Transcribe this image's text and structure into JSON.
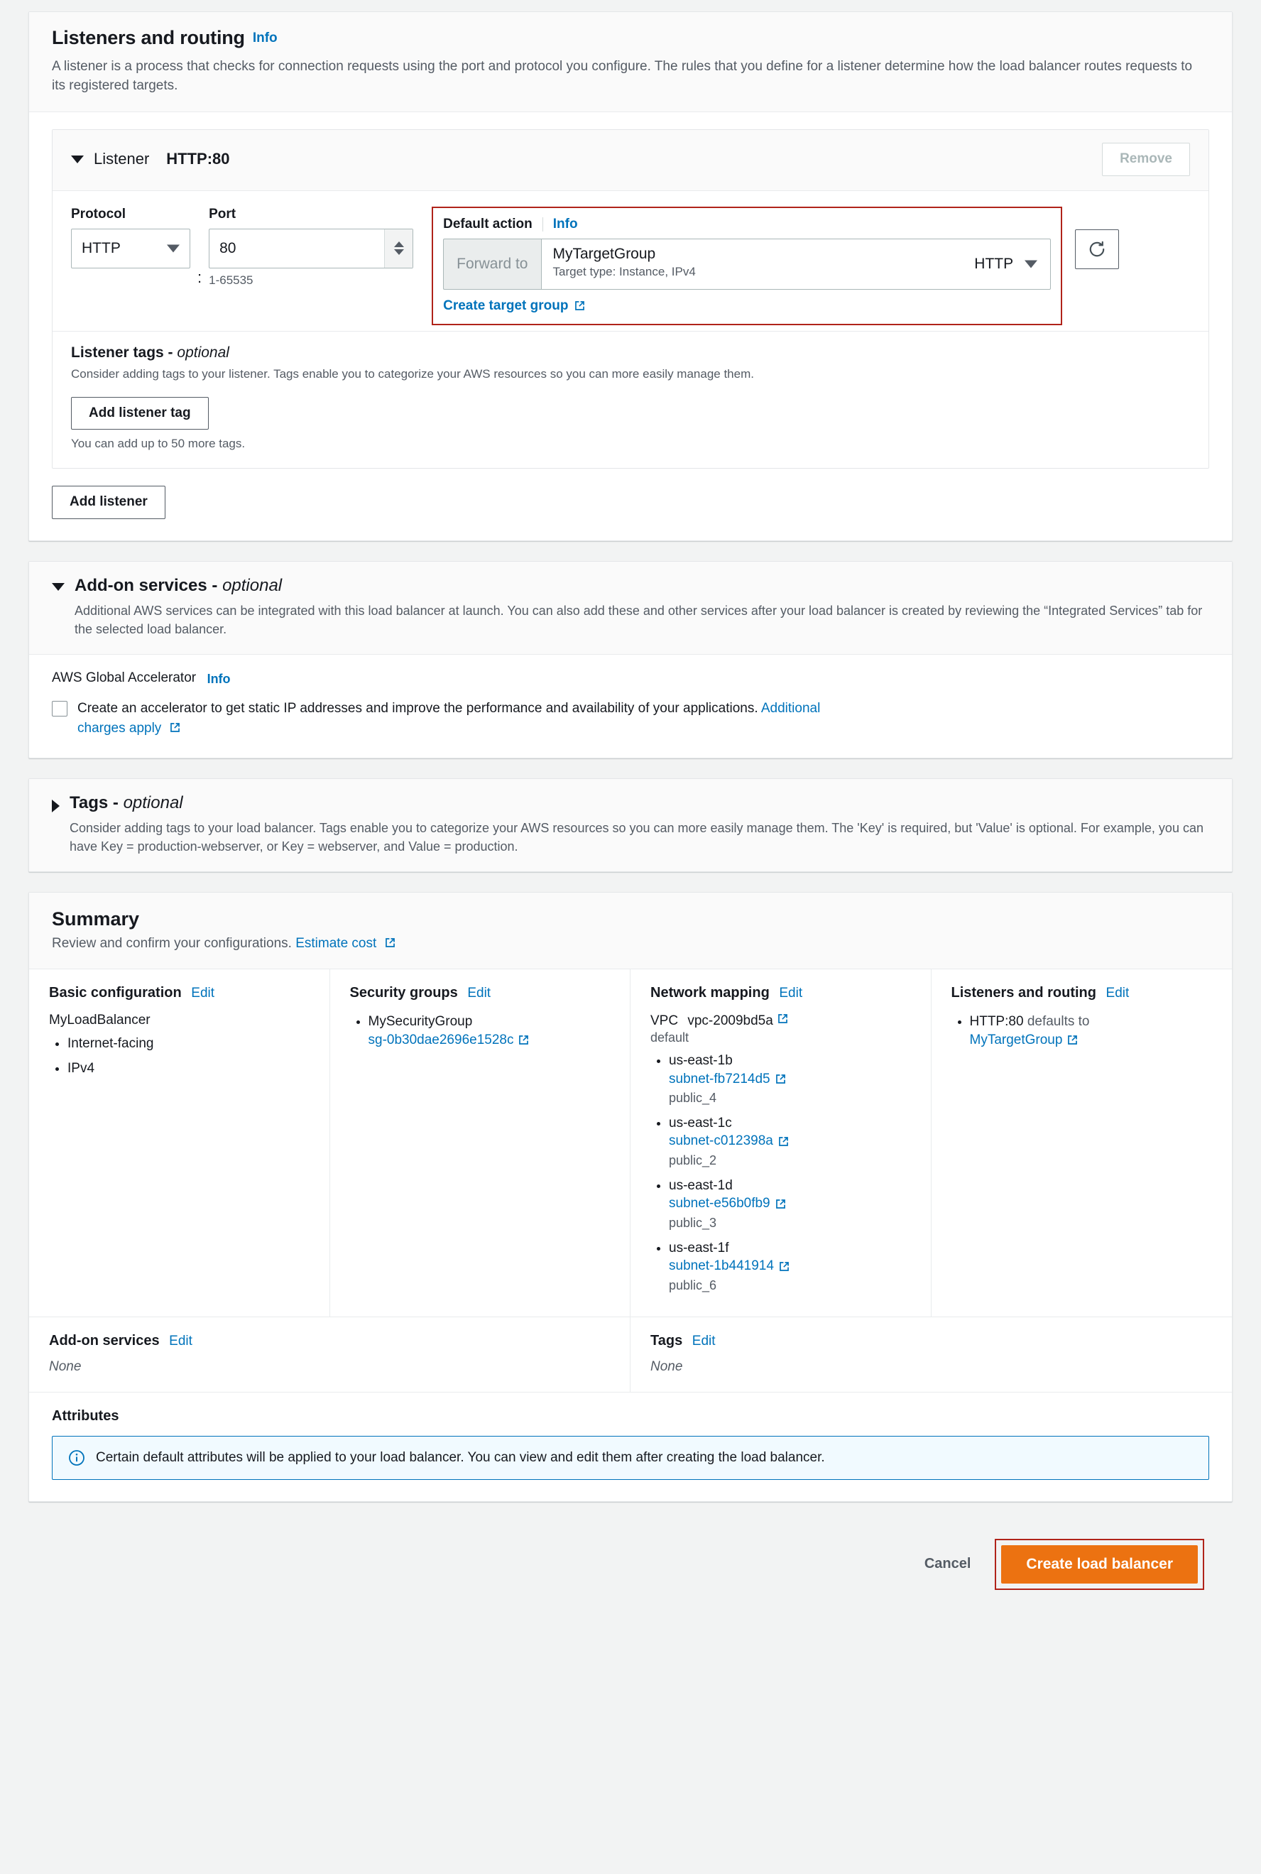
{
  "listeners_section": {
    "title": "Listeners and routing",
    "info_label": "Info",
    "description": "A listener is a process that checks for connection requests using the port and protocol you configure. The rules that you define for a listener determine how the load balancer routes requests to its registered targets.",
    "listener": {
      "label": "Listener",
      "value": "HTTP:80",
      "remove_label": "Remove",
      "protocol_label": "Protocol",
      "protocol_value": "HTTP",
      "colon": ":",
      "port_label": "Port",
      "port_value": "80",
      "port_hint": "1-65535",
      "default_action_label": "Default action",
      "default_action_info": "Info",
      "forward_to_label": "Forward to",
      "target_group_name": "MyTargetGroup",
      "target_group_sub": "Target type: Instance, IPv4",
      "target_group_protocol": "HTTP",
      "create_target_group_label": "Create target group",
      "refresh_icon": "refresh-icon",
      "tags_title": "Listener tags",
      "tags_title_optional": "optional",
      "tags_desc": "Consider adding tags to your listener. Tags enable you to categorize your AWS resources so you can more easily manage them.",
      "add_listener_tag_label": "Add listener tag",
      "tags_note": "You can add up to 50 more tags."
    },
    "add_listener_label": "Add listener"
  },
  "addon_section": {
    "title": "Add-on services",
    "title_optional": "optional",
    "description": "Additional AWS services can be integrated with this load balancer at launch. You can also add these and other services after your load balancer is created by reviewing the “Integrated Services” tab for the selected load balancer.",
    "global_accelerator_label": "AWS Global Accelerator",
    "global_accelerator_info": "Info",
    "checkbox_text": "Create an accelerator to get static IP addresses and improve the performance and availability of your applications.",
    "charges_link": "Additional charges apply",
    "checkbox_checked": false
  },
  "tags_section": {
    "title": "Tags",
    "title_optional": "optional",
    "description": "Consider adding tags to your load balancer. Tags enable you to categorize your AWS resources so you can more easily manage them. The 'Key' is required, but 'Value' is optional. For example, you can have Key = production-webserver, or Key = webserver, and Value = production."
  },
  "summary": {
    "title": "Summary",
    "subtitle_text": "Review and confirm your configurations.",
    "estimate_cost_label": "Estimate cost",
    "edit_label": "Edit",
    "basic_configuration": {
      "title": "Basic configuration",
      "name": "MyLoadBalancer",
      "items": [
        "Internet-facing",
        "IPv4"
      ]
    },
    "security_groups": {
      "title": "Security groups",
      "group_name": "MySecurityGroup",
      "group_id": "sg-0b30dae2696e1528c"
    },
    "network_mapping": {
      "title": "Network mapping",
      "vpc_label": "VPC",
      "vpc_id": "vpc-2009bd5a",
      "vpc_name": "default",
      "zones": [
        {
          "az": "us-east-1b",
          "subnet": "subnet-fb7214d5",
          "name": "public_4"
        },
        {
          "az": "us-east-1c",
          "subnet": "subnet-c012398a",
          "name": "public_2"
        },
        {
          "az": "us-east-1d",
          "subnet": "subnet-e56b0fb9",
          "name": "public_3"
        },
        {
          "az": "us-east-1f",
          "subnet": "subnet-1b441914",
          "name": "public_6"
        }
      ]
    },
    "listeners_routing": {
      "title": "Listeners and routing",
      "listener": "HTTP:80",
      "defaults_to": "defaults to",
      "target_group": "MyTargetGroup"
    },
    "addon_services": {
      "title": "Add-on services",
      "value": "None"
    },
    "tags": {
      "title": "Tags",
      "value": "None"
    },
    "attributes": {
      "title": "Attributes",
      "alert_text": "Certain default attributes will be applied to your load balancer. You can view and edit them after creating the load balancer."
    }
  },
  "footer": {
    "cancel_label": "Cancel",
    "create_label": "Create load balancer"
  },
  "colors": {
    "accent_orange": "#ec7211",
    "link_blue": "#0073bb",
    "highlight_red": "#b0231a",
    "alert_bg": "#f1faff"
  }
}
